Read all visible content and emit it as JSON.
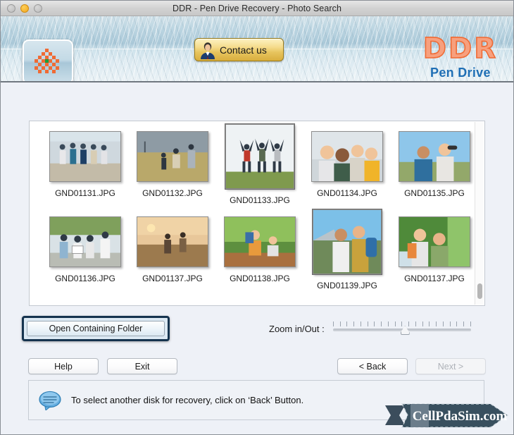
{
  "window": {
    "title": "DDR - Pen Drive Recovery - Photo Search",
    "controls": {
      "close": "close-button",
      "minimize": "minimize-button",
      "zoom": "zoom-button"
    }
  },
  "header": {
    "app_icon": "checkered-flower-icon",
    "contact_button": {
      "label": "Contact us",
      "icon": "person-icon"
    },
    "brand": {
      "name": "DDR",
      "subtitle": "Pen Drive"
    }
  },
  "thumbnails": {
    "rows": [
      [
        {
          "name": "GND01131.JPG",
          "selected": false
        },
        {
          "name": "GND01132.JPG",
          "selected": false
        },
        {
          "name": "GND01133.JPG",
          "selected": true
        },
        {
          "name": "GND01134.JPG",
          "selected": false
        },
        {
          "name": "GND01135.JPG",
          "selected": false
        }
      ],
      [
        {
          "name": "GND01136.JPG",
          "selected": false
        },
        {
          "name": "GND01137.JPG",
          "selected": false
        },
        {
          "name": "GND01138.JPG",
          "selected": false
        },
        {
          "name": "GND01139.JPG",
          "selected": true
        },
        {
          "name": "GND01137.JPG",
          "selected": false
        }
      ]
    ],
    "scrollbar": "vertical-scrollbar"
  },
  "controls": {
    "open_folder_label": "Open Containing Folder",
    "zoom_label": "Zoom in/Out :",
    "zoom_value_percent": 52,
    "zoom_tick_count": 21
  },
  "buttons": {
    "help": "Help",
    "exit": "Exit",
    "back": "< Back",
    "next": "Next >",
    "next_disabled": true
  },
  "status": {
    "icon": "speech-bubble-icon",
    "message": "To select another disk for recovery, click on ‘Back’ Button."
  },
  "watermark": {
    "text": "CellPdaSim.com"
  },
  "colors": {
    "brand_orange": "#ef6b35",
    "brand_blue": "#1f6fb5",
    "focus_border": "#16344f",
    "banner_blue": "#a9c8d8"
  }
}
